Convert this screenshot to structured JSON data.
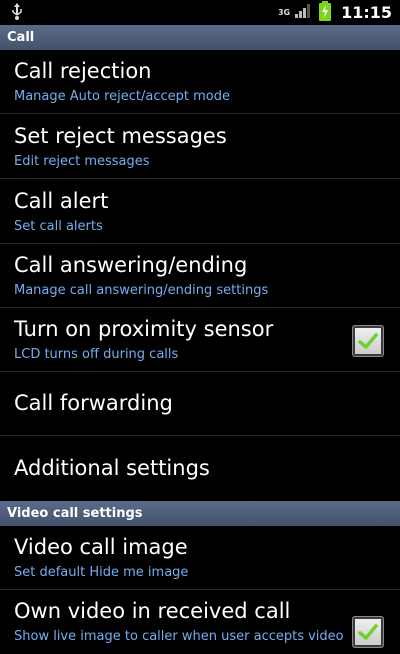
{
  "status_bar": {
    "network": "3G",
    "time": "11:15",
    "icons": [
      "usb-icon",
      "signal-icon",
      "battery-charging-icon"
    ]
  },
  "sections": [
    {
      "title": "Call"
    },
    {
      "title": "Video call settings"
    }
  ],
  "items": [
    {
      "title": "Call rejection",
      "summary": "Manage Auto reject/accept mode"
    },
    {
      "title": "Set reject messages",
      "summary": "Edit reject messages"
    },
    {
      "title": "Call alert",
      "summary": "Set call alerts"
    },
    {
      "title": "Call answering/ending",
      "summary": "Manage call answering/ending settings"
    },
    {
      "title": "Turn on proximity sensor",
      "summary": "LCD turns off during calls",
      "checked": true
    },
    {
      "title": "Call forwarding"
    },
    {
      "title": "Additional settings"
    },
    {
      "title": "Video call image",
      "summary": "Set default Hide me image"
    },
    {
      "title": "Own video in received call",
      "summary": "Show live image to caller when user accepts video",
      "checked": true
    }
  ],
  "colors": {
    "section_header": "#4f5d7a",
    "summary_text": "#74aef0",
    "checkmark": "#6fd12c"
  }
}
